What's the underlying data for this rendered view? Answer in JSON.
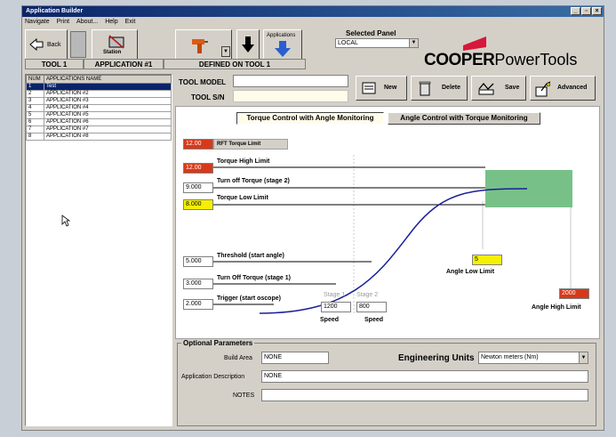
{
  "window": {
    "title": "Application Builder"
  },
  "menu": [
    "Navigate",
    "Print",
    "About...",
    "Help",
    "Exit"
  ],
  "toolbar": {
    "back_label": "Back",
    "applications_label": "Applications",
    "station_label": "Station"
  },
  "selected_panel": {
    "label": "Selected Panel",
    "value": "LOCAL"
  },
  "context_bar": {
    "tool": "TOOL 1",
    "application": "APPLICATION #1",
    "defined_on": "DEFINED ON TOOL 1"
  },
  "brand": {
    "primary": "COOPER",
    "secondary": "PowerTools"
  },
  "app_list": {
    "col_num": "NUM",
    "col_name": "APPLICATIONS NAME",
    "rows": [
      {
        "num": "1",
        "name": "Test"
      },
      {
        "num": "2",
        "name": "APPLICATION #2"
      },
      {
        "num": "3",
        "name": "APPLICATION #3"
      },
      {
        "num": "4",
        "name": "APPLICATION #4"
      },
      {
        "num": "5",
        "name": "APPLICATION #5"
      },
      {
        "num": "6",
        "name": "APPLICATION #6"
      },
      {
        "num": "7",
        "name": "APPLICATION #7"
      },
      {
        "num": "8",
        "name": "APPLICATION #8"
      }
    ]
  },
  "tool_info": {
    "model_label": "TOOL MODEL",
    "model_value": "",
    "sn_label": "TOOL S/N",
    "sn_value": ""
  },
  "actions": {
    "new": "New",
    "delete": "Delete",
    "save": "Save",
    "advanced": "Advanced"
  },
  "tabs": {
    "active": "Torque Control with Angle Monitoring",
    "inactive": "Angle Control with Torque Monitoring"
  },
  "params": {
    "rft": {
      "value": "12.00",
      "label": "RFT Torque Limit"
    },
    "torque_high": {
      "value": "12.00",
      "label": "Torque High Limit"
    },
    "turn_off_2": {
      "value": "9.000",
      "label": "Turn off Torque (stage 2)"
    },
    "torque_low": {
      "value": "8.000",
      "label": "Torque Low Limit"
    },
    "threshold": {
      "value": "5.000",
      "label": "Threshold (start angle)"
    },
    "turn_off_1": {
      "value": "3.000",
      "label": "Turn Off Torque (stage 1)"
    },
    "trigger": {
      "value": "2.000",
      "label": "Trigger (start oscope)"
    },
    "angle_low": {
      "value": "5",
      "label": "Angle Low Limit"
    },
    "angle_high": {
      "value": "2000",
      "label": "Angle High Limit"
    },
    "stage1": {
      "label": "Stage 1",
      "speed": "1200",
      "speed_label": "Speed"
    },
    "stage2": {
      "label": "Stage 2",
      "speed": "800",
      "speed_label": "Speed"
    }
  },
  "colors": {
    "red": "#d63a1a",
    "yellow": "#f5f000",
    "green": "#77c188",
    "curve": "#1a1f9a"
  },
  "optional": {
    "title": "Optional Parameters",
    "build_area_label": "Build Area",
    "build_area_value": "NONE",
    "eng_units_label": "Engineering Units",
    "eng_units_value": "Newton meters (Nm)",
    "app_desc_label": "Application Description",
    "app_desc_value": "NONE",
    "notes_label": "NOTES",
    "notes_value": ""
  }
}
